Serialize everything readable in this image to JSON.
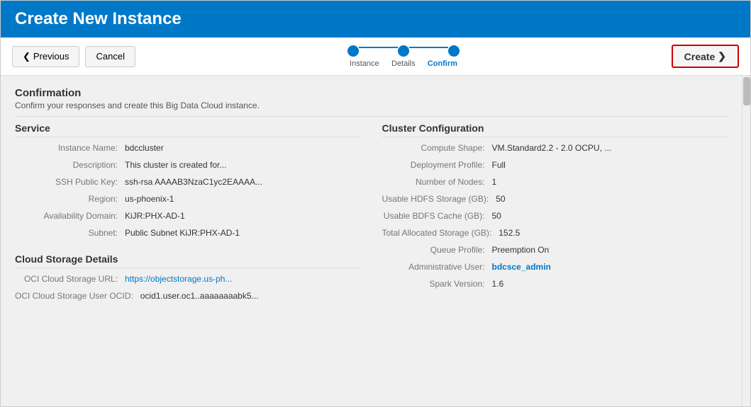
{
  "header": {
    "title": "Create New Instance"
  },
  "toolbar": {
    "previous_label": "Previous",
    "cancel_label": "Cancel",
    "create_label": "Create"
  },
  "wizard": {
    "steps": [
      {
        "label": "Instance",
        "state": "completed"
      },
      {
        "label": "Details",
        "state": "completed"
      },
      {
        "label": "Confirm",
        "state": "active"
      }
    ]
  },
  "confirmation": {
    "title": "Confirmation",
    "subtitle": "Confirm your responses and create this Big Data Cloud instance."
  },
  "service": {
    "section_title": "Service",
    "fields": [
      {
        "label": "Instance Name:",
        "value": "bdccluster",
        "type": "normal"
      },
      {
        "label": "Description:",
        "value": "This cluster is created for...",
        "type": "normal"
      },
      {
        "label": "SSH Public Key:",
        "value": "ssh-rsa AAAAB3NzaC1yc2EAAAA...",
        "type": "normal"
      },
      {
        "label": "Region:",
        "value": "us-phoenix-1",
        "type": "normal"
      },
      {
        "label": "Availability Domain:",
        "value": "KiJR:PHX-AD-1",
        "type": "normal"
      },
      {
        "label": "Subnet:",
        "value": "Public Subnet KiJR:PHX-AD-1",
        "type": "normal"
      }
    ]
  },
  "cloud_storage": {
    "section_title": "Cloud Storage Details",
    "fields": [
      {
        "label": "OCI Cloud Storage URL:",
        "value": "https://objectstorage.us-ph...",
        "type": "link"
      },
      {
        "label": "OCI Cloud Storage User OCID:",
        "value": "ocid1.user.oc1..aaaaaaaabk5...",
        "type": "normal"
      }
    ]
  },
  "cluster_config": {
    "section_title": "Cluster Configuration",
    "fields": [
      {
        "label": "Compute Shape:",
        "value": "VM.Standard2.2 - 2.0 OCPU, ...",
        "type": "normal"
      },
      {
        "label": "Deployment Profile:",
        "value": "Full",
        "type": "normal"
      },
      {
        "label": "Number of Nodes:",
        "value": "1",
        "type": "normal"
      },
      {
        "label": "Usable HDFS Storage (GB):",
        "value": "50",
        "type": "normal"
      },
      {
        "label": "Usable BDFS Cache (GB):",
        "value": "50",
        "type": "normal"
      },
      {
        "label": "Total Allocated Storage (GB):",
        "value": "152.5",
        "type": "normal"
      },
      {
        "label": "Queue Profile:",
        "value": "Preemption On",
        "type": "normal"
      },
      {
        "label": "Administrative User:",
        "value": "bdcsce_admin",
        "type": "bold-link"
      },
      {
        "label": "Spark Version:",
        "value": "1.6",
        "type": "normal"
      }
    ]
  }
}
